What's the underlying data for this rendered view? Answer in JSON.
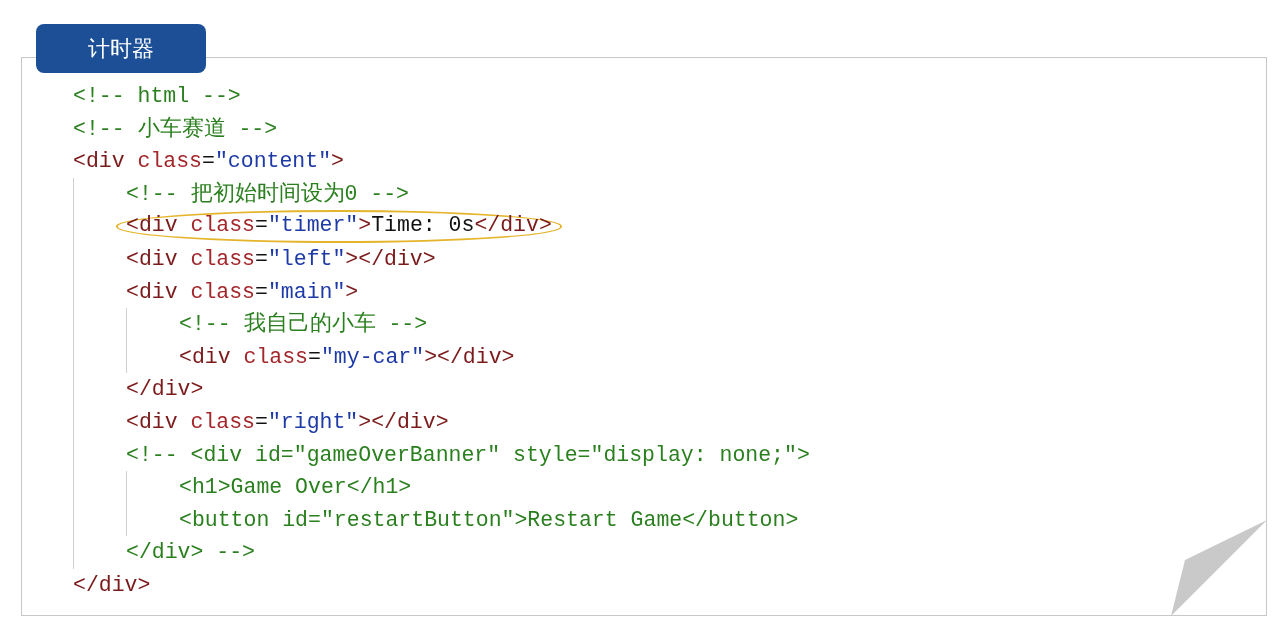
{
  "title": "计时器",
  "lines": [
    {
      "tokens": [
        {
          "kind": "comment",
          "text": "<!-- html -->"
        }
      ]
    },
    {
      "tokens": [
        {
          "kind": "comment",
          "text": "<!-- 小车赛道 -->"
        }
      ]
    },
    {
      "tokens": [
        {
          "kind": "tag",
          "text": "<div"
        },
        {
          "kind": "attr",
          "text": " class"
        },
        {
          "kind": "text",
          "text": "="
        },
        {
          "kind": "value",
          "text": "\"content\""
        },
        {
          "kind": "tag",
          "text": ">"
        }
      ],
      "children": [
        {
          "tokens": [
            {
              "kind": "comment",
              "text": "<!-- 把初始时间设为0 -->"
            }
          ]
        },
        {
          "highlighted": true,
          "tokens": [
            {
              "kind": "tag",
              "text": "<div"
            },
            {
              "kind": "attr",
              "text": " class"
            },
            {
              "kind": "text",
              "text": "="
            },
            {
              "kind": "value",
              "text": "\"timer\""
            },
            {
              "kind": "tag",
              "text": ">"
            },
            {
              "kind": "text",
              "text": "Time: 0s"
            },
            {
              "kind": "tag",
              "text": "</div>"
            }
          ]
        },
        {
          "tokens": [
            {
              "kind": "tag",
              "text": "<div"
            },
            {
              "kind": "attr",
              "text": " class"
            },
            {
              "kind": "text",
              "text": "="
            },
            {
              "kind": "value",
              "text": "\"left\""
            },
            {
              "kind": "tag",
              "text": "></div>"
            }
          ]
        },
        {
          "tokens": [
            {
              "kind": "tag",
              "text": "<div"
            },
            {
              "kind": "attr",
              "text": " class"
            },
            {
              "kind": "text",
              "text": "="
            },
            {
              "kind": "value",
              "text": "\"main\""
            },
            {
              "kind": "tag",
              "text": ">"
            }
          ],
          "children": [
            {
              "tokens": [
                {
                  "kind": "comment",
                  "text": "<!-- 我自己的小车 -->"
                }
              ]
            },
            {
              "tokens": [
                {
                  "kind": "tag",
                  "text": "<div"
                },
                {
                  "kind": "attr",
                  "text": " class"
                },
                {
                  "kind": "text",
                  "text": "="
                },
                {
                  "kind": "value",
                  "text": "\"my-car\""
                },
                {
                  "kind": "tag",
                  "text": "></div>"
                }
              ]
            }
          ]
        },
        {
          "tokens": [
            {
              "kind": "tag",
              "text": "</div>"
            }
          ]
        },
        {
          "tokens": [
            {
              "kind": "tag",
              "text": "<div"
            },
            {
              "kind": "attr",
              "text": " class"
            },
            {
              "kind": "text",
              "text": "="
            },
            {
              "kind": "value",
              "text": "\"right\""
            },
            {
              "kind": "tag",
              "text": "></div>"
            }
          ]
        },
        {
          "tokens": [
            {
              "kind": "comment",
              "text": "<!-- <div id=\"gameOverBanner\" style=\"display: none;\">"
            }
          ],
          "children": [
            {
              "tokens": [
                {
                  "kind": "comment",
                  "text": "<h1>Game Over</h1>"
                }
              ]
            },
            {
              "tokens": [
                {
                  "kind": "comment",
                  "text": "<button id=\"restartButton\">Restart Game</button>"
                }
              ]
            }
          ]
        },
        {
          "tokens": [
            {
              "kind": "comment",
              "text": "</div> -->"
            }
          ]
        }
      ]
    },
    {
      "tokens": [
        {
          "kind": "tag",
          "text": "</div>"
        }
      ]
    }
  ]
}
